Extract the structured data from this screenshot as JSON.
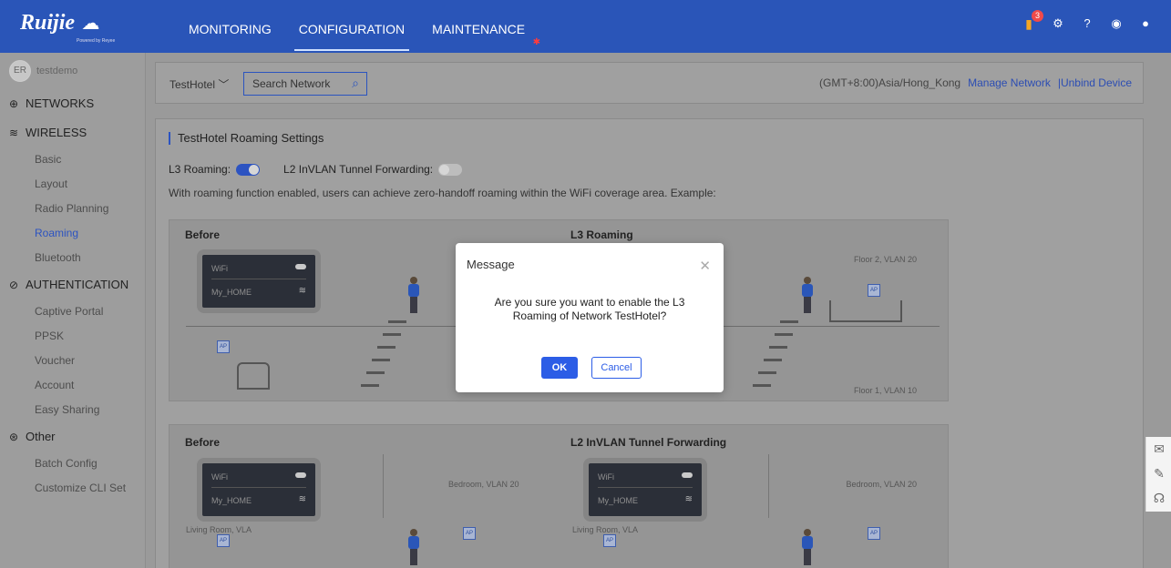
{
  "brand": {
    "name": "Ruijie",
    "powered": "Powered by Reyee"
  },
  "topnav": {
    "items": [
      "MONITORING",
      "CONFIGURATION",
      "MAINTENANCE"
    ],
    "active": "CONFIGURATION",
    "notice_count": "3"
  },
  "user": {
    "avatar": "ER",
    "name": "testdemo"
  },
  "sidebar": {
    "networks": "NETWORKS",
    "wireless": "WIRELESS",
    "wireless_items": [
      "Basic",
      "Layout",
      "Radio Planning",
      "Roaming",
      "Bluetooth"
    ],
    "authentication": "AUTHENTICATION",
    "auth_items": [
      "Captive Portal",
      "PPSK",
      "Voucher",
      "Account",
      "Easy Sharing"
    ],
    "other": "Other",
    "other_items": [
      "Batch Config",
      "Customize CLI Set"
    ],
    "active_item": "Roaming"
  },
  "header": {
    "network": "TestHotel",
    "search_placeholder": "Search Network",
    "timezone": "(GMT+8:00)Asia/Hong_Kong",
    "manage": "Manage Network",
    "unbind": "|Unbind Device"
  },
  "roaming": {
    "title": "TestHotel Roaming Settings",
    "l3_label": "L3 Roaming:",
    "l3_on": true,
    "l2_label": "L2 InVLAN Tunnel Forwarding:",
    "l2_on": false,
    "description": "With roaming function enabled, users can achieve zero-handoff roaming within the WiFi coverage area. Example:"
  },
  "illustration": {
    "before": "Before",
    "l3": "L3 Roaming",
    "l2": "L2 InVLAN Tunnel Forwarding",
    "floor2": "Floor 2, VLAN 20",
    "floor1": "Floor 1, VLAN 10",
    "bedroom": "Bedroom, VLAN 20",
    "living": "Living Room, VLA",
    "wifi": "WiFi",
    "ssid": "My_HOME",
    "ap": "AP"
  },
  "modal": {
    "title": "Message",
    "message": "Are you sure you want to enable the L3 Roaming of Network TestHotel?",
    "ok": "OK",
    "cancel": "Cancel"
  }
}
